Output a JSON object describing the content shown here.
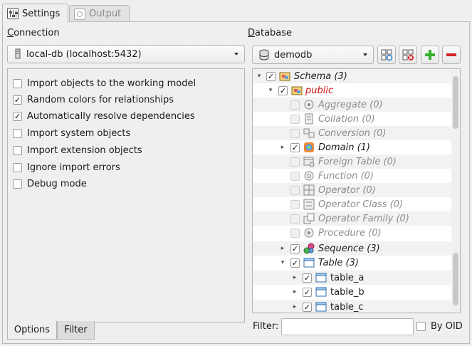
{
  "tabs": [
    {
      "label": "Settings",
      "icon": "settings-icon",
      "active": true
    },
    {
      "label": "Output",
      "icon": "output-icon",
      "active": false
    }
  ],
  "connection": {
    "label_prefix": "C",
    "label_rest": "onnection",
    "selected": "local-db (localhost:5432)",
    "icon": "database-server-icon"
  },
  "options": {
    "items": [
      {
        "label": "Import objects to the working model",
        "checked": false
      },
      {
        "label": "Random colors for relationships",
        "checked": true
      },
      {
        "label": "Automatically resolve dependencies",
        "checked": true
      },
      {
        "label": "Import system objects",
        "checked": false
      },
      {
        "label": "Import extension objects",
        "checked": false
      },
      {
        "label": "Ignore import errors",
        "checked": false
      },
      {
        "label": "Debug mode",
        "checked": false
      }
    ],
    "bottom_tabs": [
      {
        "label": "Options",
        "active": true
      },
      {
        "label": "Filter",
        "active": false
      }
    ]
  },
  "database": {
    "label_prefix": "D",
    "label_rest": "atabase",
    "selected": "demodb",
    "icon": "database-icon",
    "filter_label": "Filter:",
    "filter_value": "",
    "by_oid_label": "By OID",
    "by_oid_checked": false
  },
  "tree": [
    {
      "label": "Schema (3)",
      "level": 0,
      "expander": "expanded",
      "checked": true,
      "enabled": true,
      "style": "italic",
      "icon": "schema-icon"
    },
    {
      "label": "public",
      "level": 1,
      "expander": "expanded",
      "checked": true,
      "enabled": true,
      "style": "red",
      "icon": "schema-icon"
    },
    {
      "label": "Aggregate (0)",
      "level": 2,
      "expander": "",
      "checked": false,
      "enabled": false,
      "style": "italic",
      "icon": "aggregate-icon"
    },
    {
      "label": "Collation (0)",
      "level": 2,
      "expander": "",
      "checked": false,
      "enabled": false,
      "style": "italic",
      "icon": "collation-icon"
    },
    {
      "label": "Conversion (0)",
      "level": 2,
      "expander": "",
      "checked": false,
      "enabled": false,
      "style": "italic",
      "icon": "conversion-icon"
    },
    {
      "label": "Domain (1)",
      "level": 2,
      "expander": "collapsed",
      "checked": true,
      "enabled": true,
      "style": "italic",
      "icon": "domain-icon"
    },
    {
      "label": "Foreign Table (0)",
      "level": 2,
      "expander": "",
      "checked": false,
      "enabled": false,
      "style": "italic",
      "icon": "foreign-table-icon"
    },
    {
      "label": "Function (0)",
      "level": 2,
      "expander": "",
      "checked": false,
      "enabled": false,
      "style": "italic",
      "icon": "function-icon"
    },
    {
      "label": "Operator (0)",
      "level": 2,
      "expander": "",
      "checked": false,
      "enabled": false,
      "style": "italic",
      "icon": "operator-icon"
    },
    {
      "label": "Operator Class (0)",
      "level": 2,
      "expander": "",
      "checked": false,
      "enabled": false,
      "style": "italic",
      "icon": "operator-class-icon"
    },
    {
      "label": "Operator Family (0)",
      "level": 2,
      "expander": "",
      "checked": false,
      "enabled": false,
      "style": "italic",
      "icon": "operator-family-icon"
    },
    {
      "label": "Procedure (0)",
      "level": 2,
      "expander": "",
      "checked": false,
      "enabled": false,
      "style": "italic",
      "icon": "procedure-icon"
    },
    {
      "label": "Sequence (3)",
      "level": 2,
      "expander": "collapsed",
      "checked": true,
      "enabled": true,
      "style": "italic",
      "icon": "sequence-icon"
    },
    {
      "label": "Table (3)",
      "level": 2,
      "expander": "expanded",
      "checked": true,
      "enabled": true,
      "style": "italic",
      "icon": "table-icon"
    },
    {
      "label": "table_a",
      "level": 3,
      "expander": "collapsed",
      "checked": true,
      "enabled": true,
      "style": "normal",
      "icon": "table-icon"
    },
    {
      "label": "table_b",
      "level": 3,
      "expander": "collapsed",
      "checked": true,
      "enabled": true,
      "style": "normal",
      "icon": "table-icon"
    },
    {
      "label": "table_c",
      "level": 3,
      "expander": "collapsed",
      "checked": true,
      "enabled": true,
      "style": "normal",
      "icon": "table-icon"
    }
  ],
  "toolbar": [
    {
      "icon": "refresh-objects-icon"
    },
    {
      "icon": "drop-database-icon"
    },
    {
      "icon": "add-icon"
    },
    {
      "icon": "remove-icon"
    }
  ],
  "colors": {
    "accent": "#36b030",
    "danger": "#d22424",
    "red_label": "#d01010"
  }
}
